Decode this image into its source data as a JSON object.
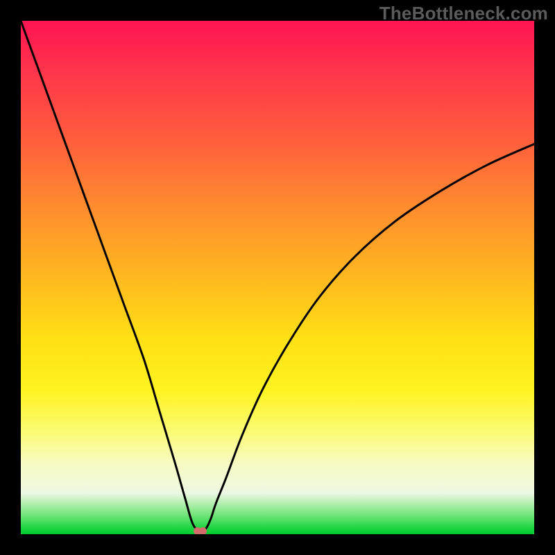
{
  "watermark": "TheBottleneck.com",
  "chart_data": {
    "type": "line",
    "title": "",
    "xlabel": "",
    "ylabel": "",
    "xlim": [
      0,
      100
    ],
    "ylim": [
      0,
      100
    ],
    "grid": false,
    "legend": false,
    "background_gradient": {
      "direction": "vertical",
      "stops": [
        {
          "pos": 0,
          "color": "#ff1452"
        },
        {
          "pos": 50,
          "color": "#ffb81f"
        },
        {
          "pos": 75,
          "color": "#fff321"
        },
        {
          "pos": 96,
          "color": "#7ae67f"
        },
        {
          "pos": 100,
          "color": "#00c82f"
        }
      ]
    },
    "series": [
      {
        "name": "bottleneck-curve",
        "color": "#000000",
        "x": [
          0,
          4,
          8,
          12,
          16,
          20,
          24,
          27,
          30,
          32,
          33.5,
          35,
          36,
          37,
          38,
          40,
          43,
          47,
          52,
          58,
          65,
          73,
          82,
          91,
          100
        ],
        "y": [
          100,
          89,
          78,
          67,
          56,
          45,
          34,
          24,
          14,
          7,
          2,
          0.5,
          1,
          3,
          6,
          11,
          19,
          28,
          37,
          46,
          54,
          61,
          67,
          72,
          76
        ]
      }
    ],
    "marker": {
      "name": "minimum-point",
      "x": 35,
      "y": 0.5,
      "color": "#d46a6a"
    }
  }
}
